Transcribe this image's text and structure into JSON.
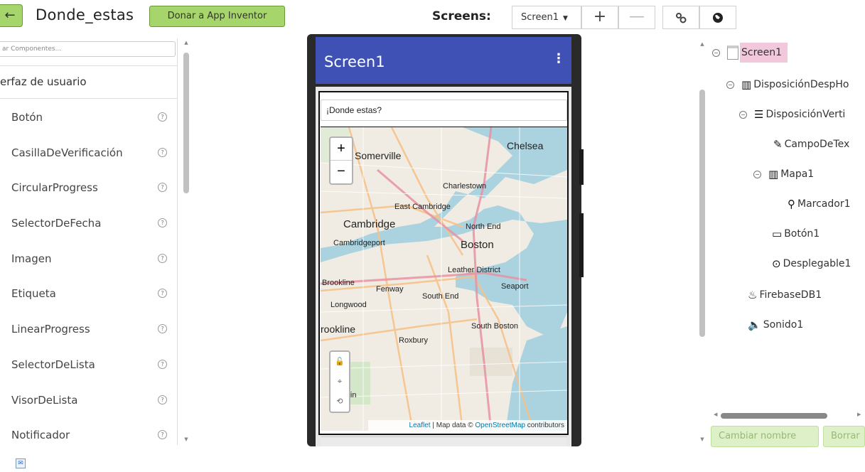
{
  "toolbar": {
    "back_icon": "arrow-left-icon",
    "project_name": "Donde_estas",
    "donate_label": "Donar a App Inventor",
    "screens_label": "Screens:",
    "screen_selected": "Screen1",
    "add_label": "+",
    "remove_label": "—",
    "settings_icon": "gears-icon",
    "globe_icon": "globe-icon"
  },
  "palette": {
    "search_placeholder": "ar Componentes...",
    "category": "erfaz de usuario",
    "items": [
      {
        "label": "Botón"
      },
      {
        "label": "CasillaDeVerificación"
      },
      {
        "label": "CircularProgress"
      },
      {
        "label": "SelectorDeFecha"
      },
      {
        "label": "Imagen"
      },
      {
        "label": "Etiqueta"
      },
      {
        "label": "LinearProgress"
      },
      {
        "label": "SelectorDeLista"
      },
      {
        "label": "VisorDeLista"
      },
      {
        "label": "Notificador"
      }
    ],
    "help_glyph": "?"
  },
  "viewer": {
    "screen_title": "Screen1",
    "menu_glyph": "⋮",
    "textbox_value": "¡Donde estas?",
    "zoom_in": "+",
    "zoom_out": "−",
    "attribution_leaflet": "Leaflet",
    "attribution_middle": " | Map data © ",
    "attribution_osm": "OpenStreetMap",
    "attribution_end": " contributors",
    "map_labels": [
      "Somerville",
      "Chelsea",
      "Charlestown",
      "East Cambridge",
      "Cambridge",
      "North End",
      "Cambridgeport",
      "Boston",
      "Leather District",
      "Brookline",
      "Fenway",
      "Seaport",
      "South End",
      "Longwood",
      "rookline",
      "South Boston",
      "Roxbury",
      "Plain"
    ]
  },
  "tree": {
    "nodes": [
      {
        "label": "Screen1",
        "icon": "screen-icon"
      },
      {
        "label": "DisposiciónDespHo",
        "icon": "horizontal-arrangement-icon"
      },
      {
        "label": "DisposiciónVerti",
        "icon": "vertical-arrangement-icon"
      },
      {
        "label": "CampoDeTex",
        "icon": "textbox-icon"
      },
      {
        "label": "Mapa1",
        "icon": "map-icon"
      },
      {
        "label": "Marcador1",
        "icon": "marker-icon"
      },
      {
        "label": "Botón1",
        "icon": "button-icon"
      },
      {
        "label": "Desplegable1",
        "icon": "spinner-icon"
      },
      {
        "label": "FirebaseDB1",
        "icon": "firebase-icon"
      },
      {
        "label": "Sonido1",
        "icon": "sound-icon"
      }
    ],
    "rename_label": "Cambiar nombre",
    "delete_label": "Borrar"
  },
  "colors": {
    "appbar": "#3f51b5",
    "accent_green": "#a6d56b",
    "selected_node": "#f2c8dc"
  }
}
